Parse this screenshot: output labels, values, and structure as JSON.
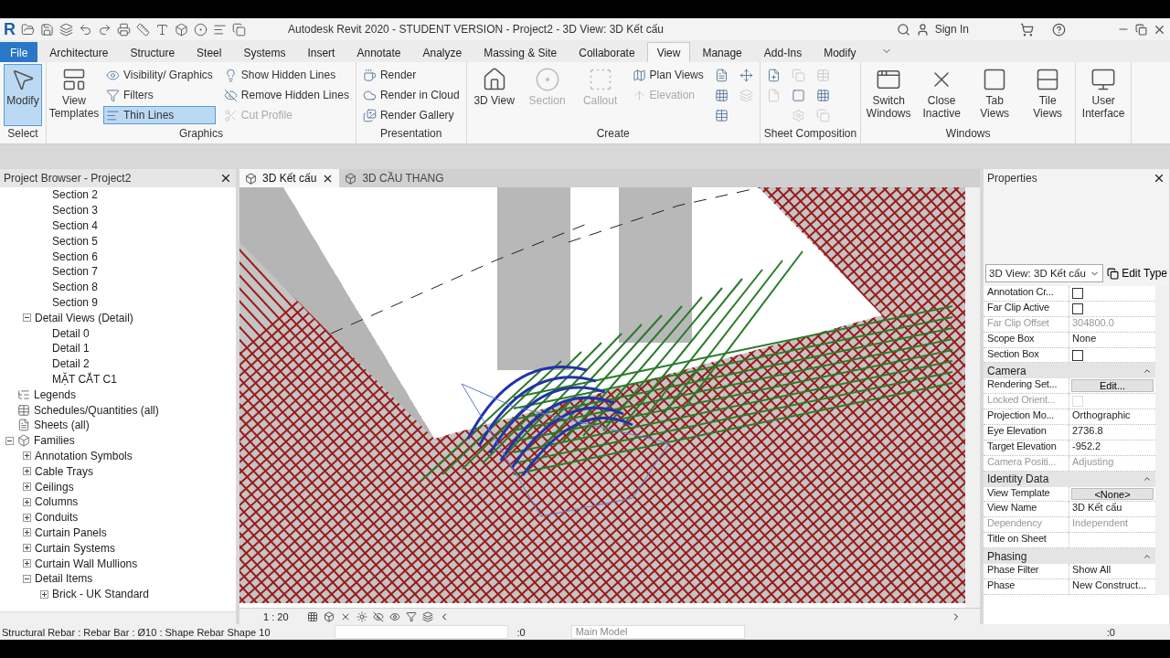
{
  "title_bar": {
    "logo": "R",
    "title": "Autodesk Revit 2020 - STUDENT VERSION - Project2 - 3D View: 3D Kết cấu",
    "sign_in": "Sign In"
  },
  "menu_tabs": [
    {
      "label": "File",
      "kind": "file",
      "selected": false
    },
    {
      "label": "Architecture",
      "kind": "tab",
      "selected": false
    },
    {
      "label": "Structure",
      "kind": "tab",
      "selected": false
    },
    {
      "label": "Steel",
      "kind": "tab",
      "selected": false
    },
    {
      "label": "Systems",
      "kind": "tab",
      "selected": false
    },
    {
      "label": "Insert",
      "kind": "tab",
      "selected": false
    },
    {
      "label": "Annotate",
      "kind": "tab",
      "selected": false
    },
    {
      "label": "Analyze",
      "kind": "tab",
      "selected": false
    },
    {
      "label": "Massing & Site",
      "kind": "tab",
      "selected": false
    },
    {
      "label": "Collaborate",
      "kind": "tab",
      "selected": false
    },
    {
      "label": "View",
      "kind": "tab",
      "selected": true
    },
    {
      "label": "Manage",
      "kind": "tab",
      "selected": false
    },
    {
      "label": "Add-Ins",
      "kind": "tab",
      "selected": false
    },
    {
      "label": "Modify",
      "kind": "tab",
      "selected": false
    }
  ],
  "ribbon": [
    {
      "title": "Select",
      "items": [
        {
          "kind": "large",
          "label": "Modify",
          "selected": true,
          "disabled": false
        }
      ]
    },
    {
      "title": "Graphics",
      "items": [
        {
          "kind": "large",
          "label": "View Templates",
          "selected": false,
          "disabled": false
        },
        {
          "kind": "stack",
          "buttons": [
            {
              "label": "Visibility/ Graphics",
              "selected": false,
              "disabled": false
            },
            {
              "label": "Filters",
              "selected": false,
              "disabled": false
            },
            {
              "label": "Thin Lines",
              "selected": true,
              "disabled": false
            }
          ]
        },
        {
          "kind": "stack",
          "buttons": [
            {
              "label": "Show Hidden Lines",
              "selected": false,
              "disabled": false
            },
            {
              "label": "Remove Hidden Lines",
              "selected": false,
              "disabled": false
            },
            {
              "label": "Cut Profile",
              "selected": false,
              "disabled": true
            }
          ]
        }
      ]
    },
    {
      "title": "Presentation",
      "items": [
        {
          "kind": "stack",
          "buttons": [
            {
              "label": "Render",
              "selected": false,
              "disabled": false
            },
            {
              "label": "Render in Cloud",
              "selected": false,
              "disabled": false
            },
            {
              "label": "Render Gallery",
              "selected": false,
              "disabled": false
            }
          ]
        }
      ]
    },
    {
      "title": "Create",
      "items": [
        {
          "kind": "large",
          "label": "3D View",
          "selected": false,
          "disabled": false
        },
        {
          "kind": "large",
          "label": "Section",
          "selected": false,
          "disabled": true
        },
        {
          "kind": "large",
          "label": "Callout",
          "selected": false,
          "disabled": true
        },
        {
          "kind": "stack",
          "buttons": [
            {
              "label": "Plan Views",
              "selected": false,
              "disabled": false
            },
            {
              "label": "Elevation",
              "selected": false,
              "disabled": true
            }
          ]
        },
        {
          "kind": "stack",
          "buttons": [
            {
              "selected": false,
              "disabled": false
            },
            {
              "selected": false,
              "disabled": false
            },
            {
              "selected": false,
              "disabled": false
            }
          ]
        },
        {
          "kind": "stack",
          "buttons": [
            {
              "selected": false,
              "disabled": false
            },
            {
              "selected": false,
              "disabled": true
            }
          ]
        }
      ]
    },
    {
      "title": "Sheet Composition",
      "items": [
        {
          "kind": "stack",
          "buttons": [
            {
              "selected": false,
              "disabled": false
            },
            {
              "selected": false,
              "disabled": true
            }
          ]
        },
        {
          "kind": "stack",
          "buttons": [
            {
              "selected": false,
              "disabled": true
            },
            {
              "selected": false,
              "disabled": false
            },
            {
              "selected": false,
              "disabled": true
            }
          ]
        },
        {
          "kind": "stack",
          "buttons": [
            {
              "selected": false,
              "disabled": true
            },
            {
              "selected": false,
              "disabled": false
            },
            {
              "selected": false,
              "disabled": true
            }
          ]
        }
      ]
    },
    {
      "title": "Windows",
      "items": [
        {
          "kind": "large",
          "label": "Switch Windows",
          "selected": false,
          "disabled": false
        },
        {
          "kind": "large",
          "label": "Close Inactive",
          "selected": false,
          "disabled": false
        },
        {
          "kind": "large",
          "label": "Tab Views",
          "selected": false,
          "disabled": false
        },
        {
          "kind": "large",
          "label": "Tile Views",
          "selected": false,
          "disabled": false
        }
      ]
    },
    {
      "items": [
        {
          "kind": "large",
          "label": "User Interface",
          "selected": false,
          "disabled": false
        }
      ]
    }
  ],
  "project_browser": {
    "title": "Project Browser - Project2",
    "tree": [
      {
        "children": [
          {
            "children": [
              {
                "label": "Section 2"
              },
              {
                "label": "Section 3"
              },
              {
                "label": "Section 4"
              },
              {
                "label": "Section 5"
              },
              {
                "label": "Section 6"
              },
              {
                "label": "Section 7"
              },
              {
                "label": "Section 8"
              },
              {
                "label": "Section 9"
              }
            ]
          },
          {
            "label": "Detail Views (Detail)",
            "expanded": true,
            "children": [
              {
                "label": "Detail 0"
              },
              {
                "label": "Detail 1"
              },
              {
                "label": "Detail 2"
              },
              {
                "label": "MẶT CẮT C1"
              }
            ]
          }
        ]
      },
      {
        "label": "Legends",
        "kind": "legend"
      },
      {
        "label": "Schedules/Quantities (all)",
        "kind": "schedule"
      },
      {
        "label": "Sheets (all)",
        "kind": "sheet"
      },
      {
        "label": "Families",
        "kind": "family",
        "expanded": true,
        "children": [
          {
            "label": "Annotation Symbols",
            "expanded": false
          },
          {
            "label": "Cable Trays",
            "expanded": false
          },
          {
            "label": "Ceilings",
            "expanded": false
          },
          {
            "label": "Columns",
            "expanded": false
          },
          {
            "label": "Conduits",
            "expanded": false
          },
          {
            "label": "Curtain Panels",
            "expanded": false
          },
          {
            "label": "Curtain Systems",
            "expanded": false
          },
          {
            "label": "Curtain Wall Mullions",
            "expanded": false
          },
          {
            "label": "Detail Items",
            "expanded": true,
            "children": [
              {
                "label": "Brick - UK Standard",
                "expanded": false
              }
            ]
          }
        ]
      }
    ]
  },
  "view_tabs": [
    {
      "label": "3D Kết cấu",
      "selected": true
    },
    {
      "label": "3D CẦU THANG",
      "selected": false
    }
  ],
  "view_scale": "1 : 20",
  "properties": {
    "title": "Properties",
    "type_selector": "3D View: 3D Kết cấu",
    "edit_type": "Edit Type",
    "rows": [
      {
        "kind": "checkbox",
        "label": "Annotation Cr...",
        "checked": false,
        "disabled": false
      },
      {
        "kind": "checkbox",
        "label": "Far Clip Active",
        "checked": false,
        "disabled": false
      },
      {
        "kind": "text",
        "label": "Far Clip Offset",
        "value": "304800.0",
        "disabled": true
      },
      {
        "kind": "text",
        "label": "Scope Box",
        "value": "None",
        "disabled": false
      },
      {
        "kind": "checkbox",
        "label": "Section Box",
        "checked": false,
        "disabled": false
      },
      {
        "kind": "header",
        "label": "Camera"
      },
      {
        "kind": "button",
        "label": "Rendering Set...",
        "value": "Edit...",
        "disabled": false
      },
      {
        "kind": "checkbox",
        "label": "Locked Orient...",
        "checked": false,
        "disabled": true
      },
      {
        "kind": "text",
        "label": "Projection Mo...",
        "value": "Orthographic",
        "disabled": false
      },
      {
        "kind": "text",
        "label": "Eye Elevation",
        "value": "2736.8",
        "disabled": false
      },
      {
        "kind": "text",
        "label": "Target Elevation",
        "value": "-952.2",
        "disabled": false
      },
      {
        "kind": "text",
        "label": "Camera Positi...",
        "value": "Adjusting",
        "disabled": true
      },
      {
        "kind": "header",
        "label": "Identity Data"
      },
      {
        "kind": "button",
        "label": "View Template",
        "value": "<None>",
        "disabled": false
      },
      {
        "kind": "text",
        "label": "View Name",
        "value": "3D Kết cấu",
        "disabled": false
      },
      {
        "kind": "text",
        "label": "Dependency",
        "value": "Independent",
        "disabled": true
      },
      {
        "kind": "text",
        "label": "Title on Sheet",
        "disabled": false
      },
      {
        "kind": "header",
        "label": "Phasing"
      },
      {
        "kind": "text",
        "label": "Phase Filter",
        "value": "Show All",
        "disabled": false
      },
      {
        "kind": "text",
        "label": "Phase",
        "value": "New Construct...",
        "disabled": false
      }
    ]
  },
  "status_bar": {
    "text": "Structural Rebar : Rebar Bar : Ø10 : Shape Rebar Shape 10",
    "count": ":0",
    "model": "Main Model",
    "filter_count": ":0"
  }
}
